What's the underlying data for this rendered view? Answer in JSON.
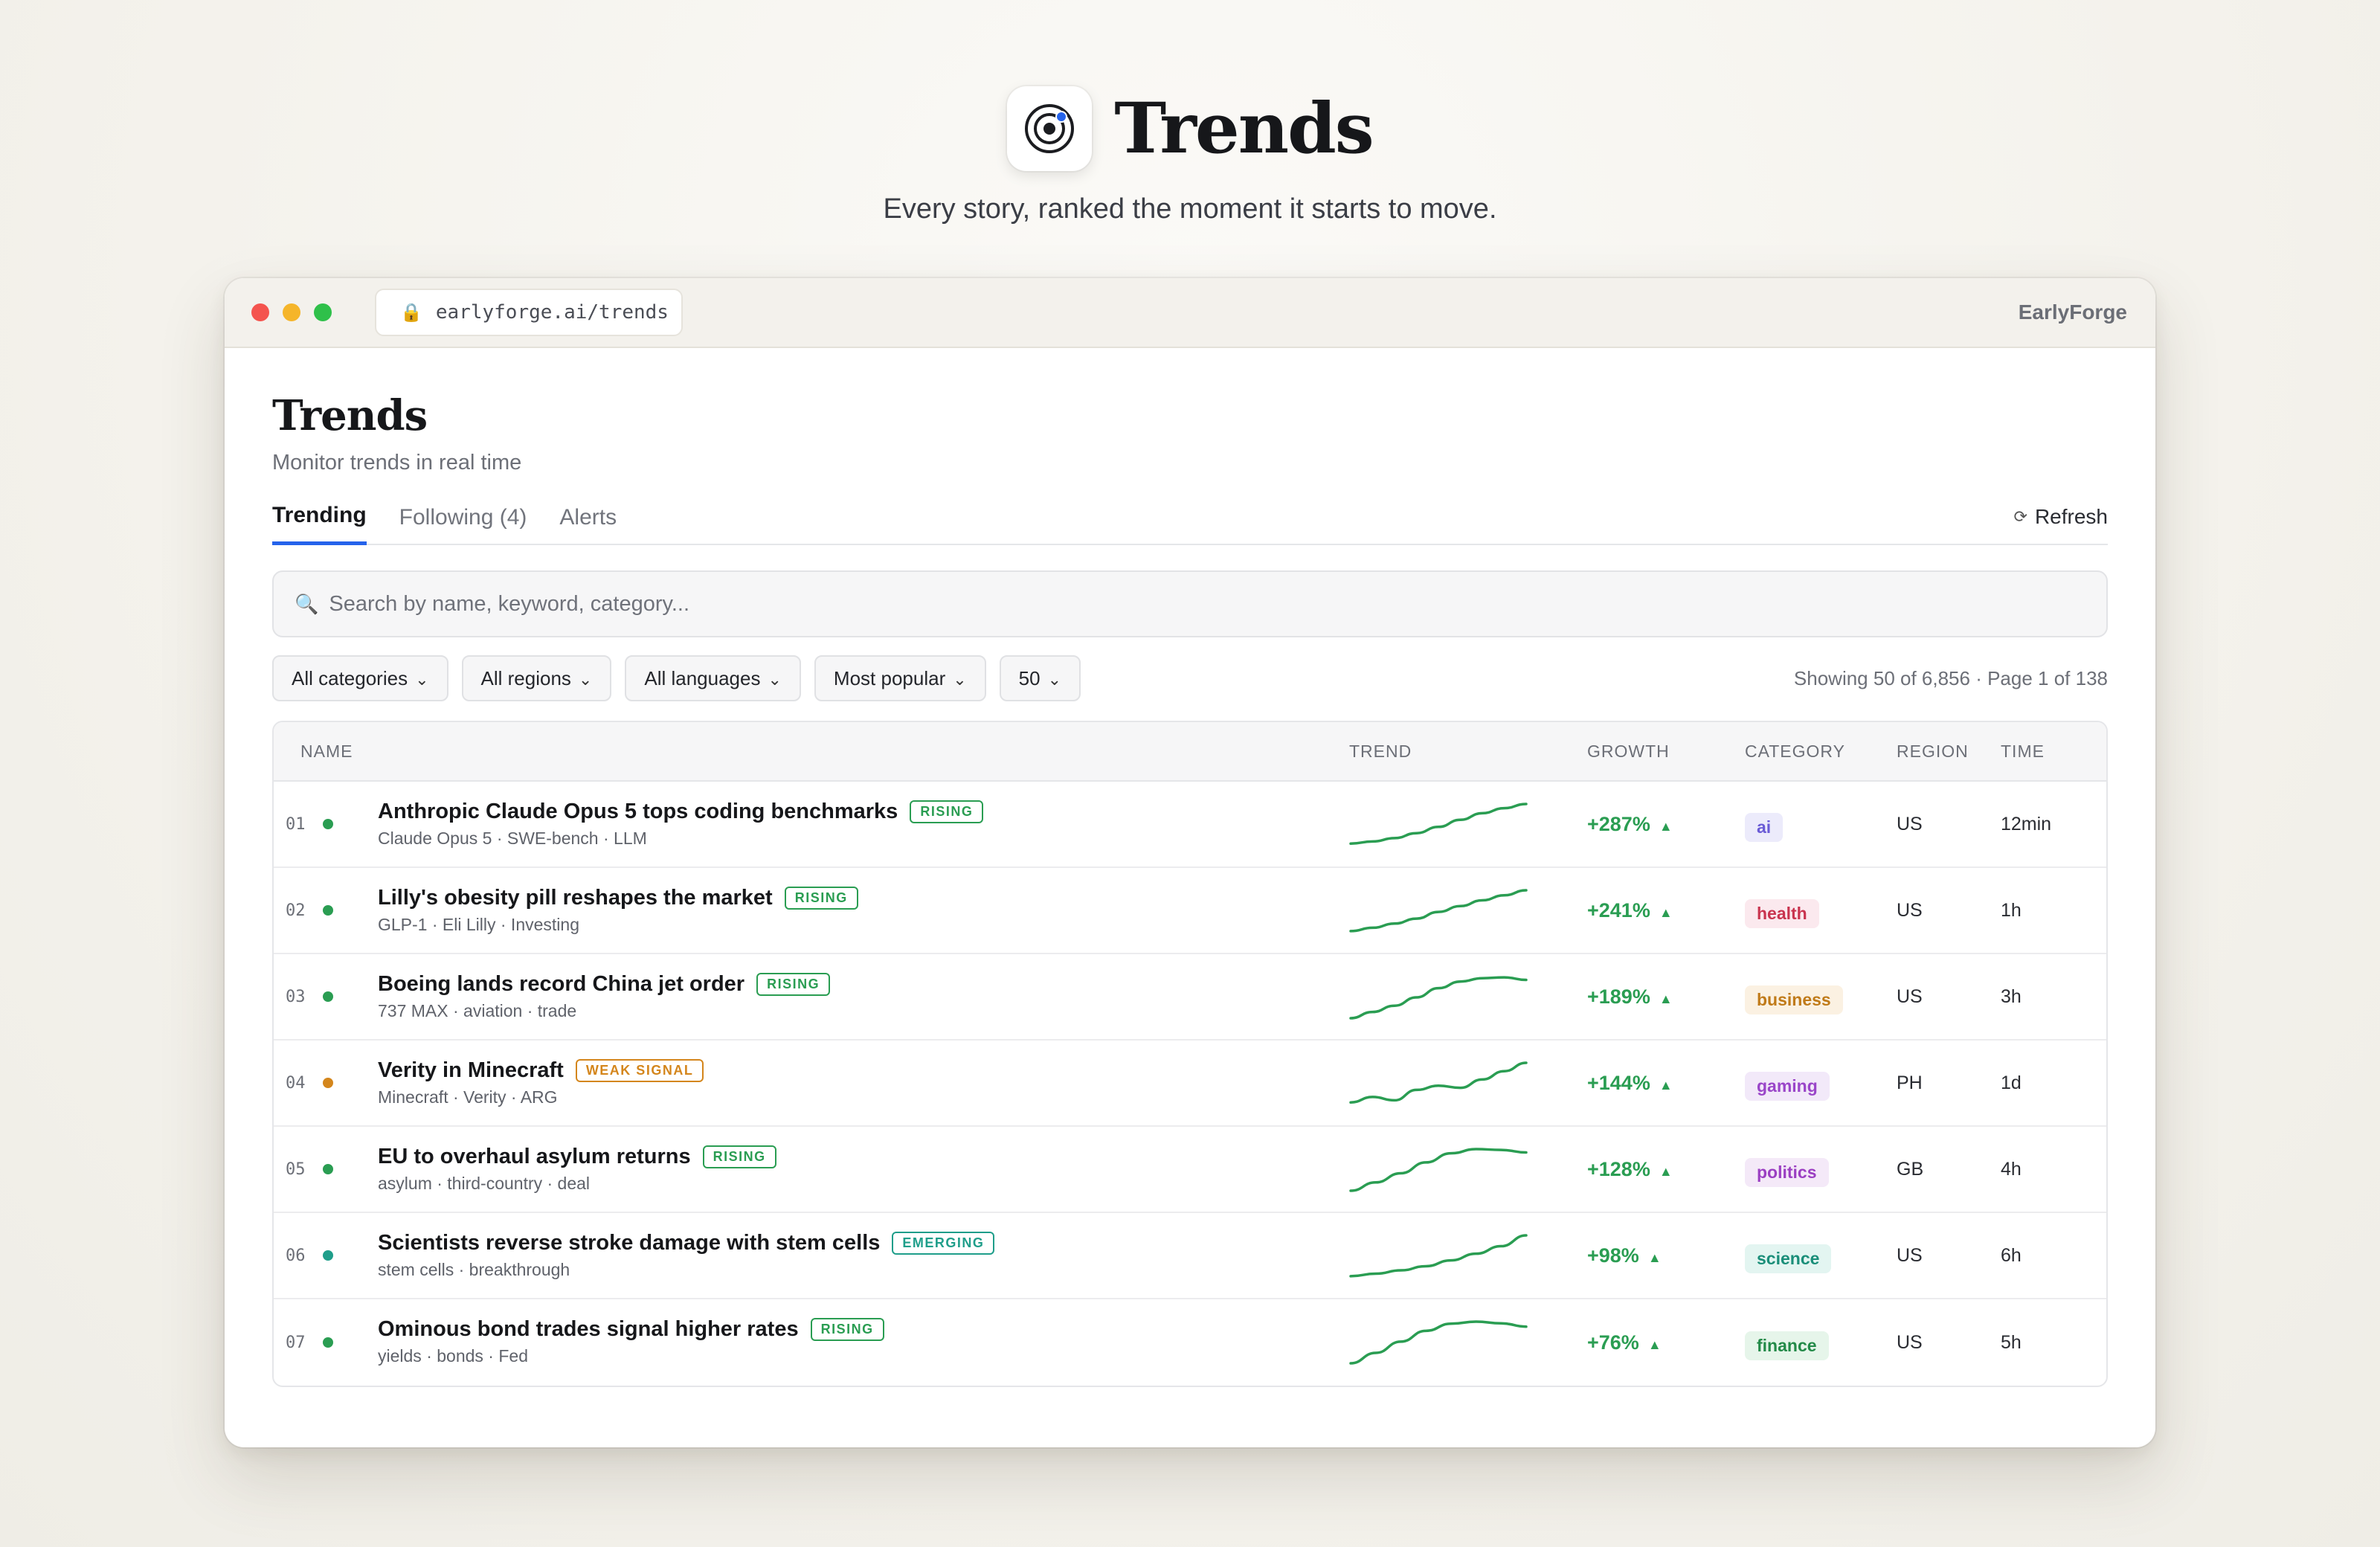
{
  "hero": {
    "title": "Trends",
    "subtitle": "Every story, ranked the moment it starts to move.",
    "icon": "target-icon"
  },
  "window": {
    "url": "earlyforge.ai/trends",
    "brand": "EarlyForge"
  },
  "page": {
    "title": "Trends",
    "subtitle": "Monitor trends in real time"
  },
  "tabs": [
    {
      "label": "Trending",
      "active": true
    },
    {
      "label": "Following (4)",
      "active": false
    },
    {
      "label": "Alerts",
      "active": false
    }
  ],
  "refresh_label": "Refresh",
  "search": {
    "placeholder": "Search by name, keyword, category..."
  },
  "filters": [
    {
      "label": "All categories"
    },
    {
      "label": "All regions"
    },
    {
      "label": "All languages"
    },
    {
      "label": "Most popular"
    },
    {
      "label": "50"
    }
  ],
  "showing": "Showing 50 of 6,856 · Page 1 of 138",
  "table": {
    "headers": {
      "name": "NAME",
      "trend": "TREND",
      "growth": "GROWTH",
      "category": "CATEGORY",
      "region": "REGION",
      "time": "TIME"
    },
    "rows": [
      {
        "rank": "01",
        "dot": "#2a9d52",
        "title": "Anthropic Claude Opus 5 tops coding benchmarks",
        "signal": "RISING",
        "tags": "Claude Opus 5 · SWE-bench · LLM",
        "growth": "+287%",
        "category": "ai",
        "region": "US",
        "time": "12min",
        "spark": [
          0.05,
          0.1,
          0.18,
          0.3,
          0.45,
          0.62,
          0.78,
          0.9,
          1.0
        ]
      },
      {
        "rank": "02",
        "dot": "#2a9d52",
        "title": "Lilly's obesity pill reshapes the market",
        "signal": "RISING",
        "tags": "GLP-1 · Eli Lilly · Investing",
        "growth": "+241%",
        "category": "health",
        "region": "US",
        "time": "1h",
        "spark": [
          0.02,
          0.1,
          0.2,
          0.32,
          0.48,
          0.62,
          0.76,
          0.88,
          1.0
        ]
      },
      {
        "rank": "03",
        "dot": "#2a9d52",
        "title": "Boeing lands record China jet order",
        "signal": "RISING",
        "tags": "737 MAX · aviation · trade",
        "growth": "+189%",
        "category": "business",
        "region": "US",
        "time": "3h",
        "spark": [
          0.0,
          0.15,
          0.3,
          0.5,
          0.72,
          0.88,
          0.96,
          0.98,
          0.92
        ]
      },
      {
        "rank": "04",
        "dot": "#d4861c",
        "title": "Verity in Minecraft",
        "signal": "WEAK SIGNAL",
        "tags": "Minecraft · Verity · ARG",
        "growth": "+144%",
        "category": "gaming",
        "region": "PH",
        "time": "1d",
        "spark": [
          0.05,
          0.18,
          0.1,
          0.35,
          0.45,
          0.4,
          0.6,
          0.8,
          1.0
        ]
      },
      {
        "rank": "05",
        "dot": "#2a9d52",
        "title": "EU to overhaul asylum returns",
        "signal": "RISING",
        "tags": "asylum · third-country · deal",
        "growth": "+128%",
        "category": "politics",
        "region": "GB",
        "time": "4h",
        "spark": [
          0.0,
          0.2,
          0.42,
          0.68,
          0.9,
          1.0,
          0.98,
          0.92
        ]
      },
      {
        "rank": "06",
        "dot": "#1f9e8a",
        "title": "Scientists reverse stroke damage with stem cells",
        "signal": "EMERGING",
        "tags": "stem cells · breakthrough",
        "growth": "+98%",
        "category": "science",
        "region": "US",
        "time": "6h",
        "spark": [
          0.02,
          0.08,
          0.16,
          0.26,
          0.4,
          0.56,
          0.74,
          1.0
        ]
      },
      {
        "rank": "07",
        "dot": "#2a9d52",
        "title": "Ominous bond trades signal higher rates",
        "signal": "RISING",
        "tags": "yields · bonds · Fed",
        "growth": "+76%",
        "category": "finance",
        "region": "US",
        "time": "5h",
        "spark": [
          0.0,
          0.25,
          0.52,
          0.78,
          0.95,
          1.0,
          0.96,
          0.88
        ]
      }
    ]
  },
  "colors": {
    "accent": "#2563eb",
    "growth": "#2a9d52",
    "rising": "#2a9d52",
    "weak_signal": "#d4861c",
    "emerging": "#1f9e8a",
    "category": {
      "ai": {
        "bg": "#ecebfb",
        "fg": "#6a5bd6"
      },
      "health": {
        "bg": "#fbe9ee",
        "fg": "#c9344f"
      },
      "business": {
        "bg": "#fbf1e2",
        "fg": "#c07a18"
      },
      "gaming": {
        "bg": "#f2e9f9",
        "fg": "#9a46c9"
      },
      "politics": {
        "bg": "#f4e9f8",
        "fg": "#9b3fc2"
      },
      "science": {
        "bg": "#e3f5f1",
        "fg": "#1a8e79"
      },
      "finance": {
        "bg": "#e6f5ea",
        "fg": "#238a48"
      }
    }
  }
}
